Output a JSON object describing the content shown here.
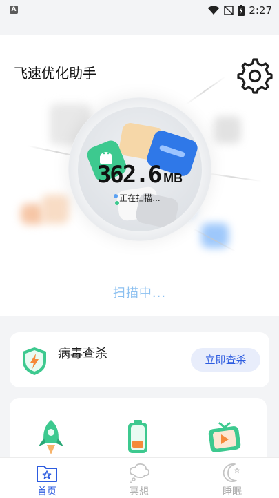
{
  "status_bar": {
    "left_icon_letter": "A",
    "time": "2:27",
    "icons": [
      "wifi-icon",
      "signal-off-icon",
      "battery-icon"
    ]
  },
  "header": {
    "title": "飞速优化助手",
    "settings_icon": "gear-icon"
  },
  "scan": {
    "value": "362.6",
    "unit": "MB",
    "status": "正在扫描...",
    "progress_text": "扫描中..."
  },
  "virus": {
    "label": "病毒查杀",
    "button_label": "立即查杀",
    "icon": "shield-bolt-icon"
  },
  "tools": {
    "items": [
      {
        "icon": "rocket-icon"
      },
      {
        "icon": "battery-charge-icon"
      },
      {
        "icon": "video-tv-icon"
      }
    ]
  },
  "tab_bar": {
    "tabs": [
      {
        "label": "首页",
        "icon": "home-folder-icon",
        "active": true
      },
      {
        "label": "冥想",
        "icon": "cloud-thought-icon",
        "active": false
      },
      {
        "label": "睡眠",
        "icon": "moon-icon",
        "active": false
      }
    ]
  },
  "colors": {
    "accent": "#2d5ce0",
    "scanning_text": "#8cc0f0",
    "active_tab": "#2d5ce0",
    "inactive_tab": "#c4c4c4",
    "green_icon": "#3dc98f"
  }
}
